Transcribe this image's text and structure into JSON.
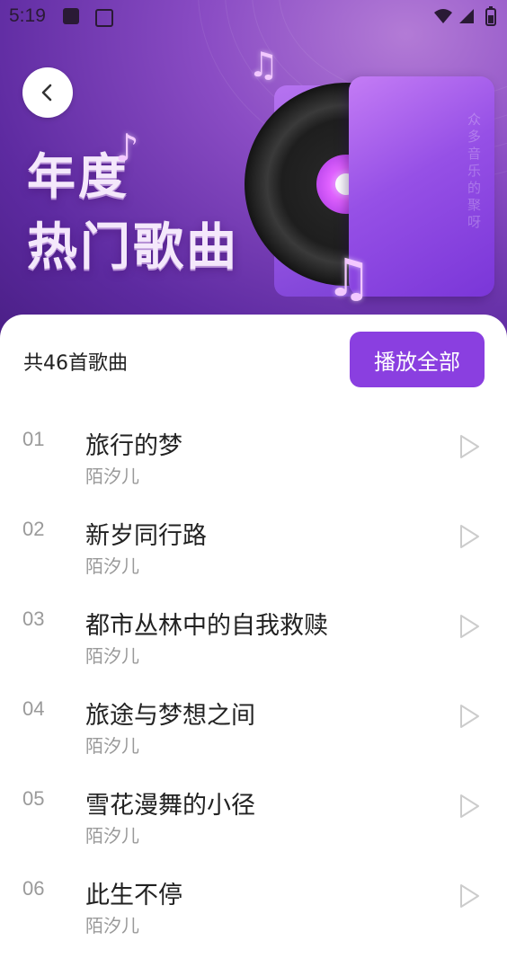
{
  "status_bar": {
    "time": "5:19"
  },
  "header": {
    "back_icon": "chevron-left-icon",
    "title_line1": "年度",
    "title_line2": "热门歌曲",
    "card_text": "众多音乐的聚呀"
  },
  "playlist": {
    "count_label": "共46首歌曲",
    "play_all_label": "播放全部",
    "accent_color": "#8a3fe0",
    "songs": [
      {
        "num": "01",
        "title": "旅行的梦",
        "artist": "陌汐儿"
      },
      {
        "num": "02",
        "title": "新岁同行路",
        "artist": "陌汐儿"
      },
      {
        "num": "03",
        "title": "都市丛林中的自我救赎",
        "artist": "陌汐儿"
      },
      {
        "num": "04",
        "title": "旅途与梦想之间",
        "artist": "陌汐儿"
      },
      {
        "num": "05",
        "title": "雪花漫舞的小径",
        "artist": "陌汐儿"
      },
      {
        "num": "06",
        "title": "此生不停",
        "artist": "陌汐儿"
      }
    ]
  }
}
